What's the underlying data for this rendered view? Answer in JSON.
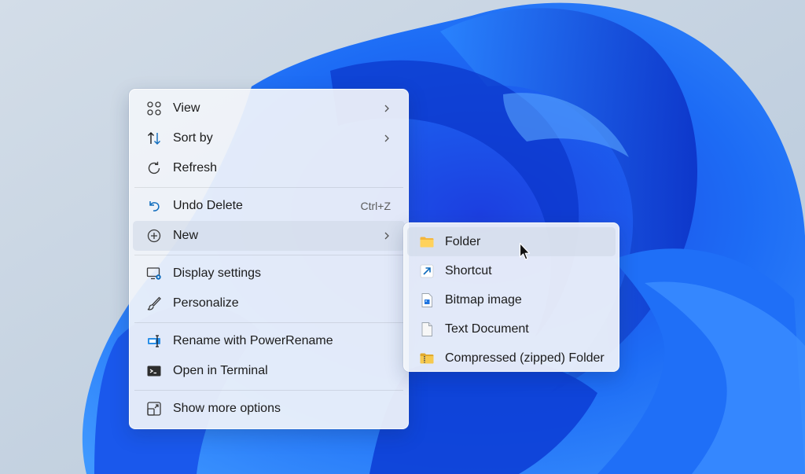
{
  "context_menu": {
    "items": [
      {
        "label": "View",
        "icon": "grid-icon"
      },
      {
        "label": "Sort by",
        "icon": "sort-icon"
      },
      {
        "label": "Refresh",
        "icon": "refresh-icon"
      },
      {
        "label": "Undo Delete",
        "shortcut": "Ctrl+Z",
        "icon": "undo-icon"
      },
      {
        "label": "New",
        "icon": "plus-circle-icon"
      },
      {
        "label": "Display settings",
        "icon": "display-settings-icon"
      },
      {
        "label": "Personalize",
        "icon": "brush-icon"
      },
      {
        "label": "Rename with PowerRename",
        "icon": "powerrename-icon"
      },
      {
        "label": "Open in Terminal",
        "icon": "terminal-icon"
      },
      {
        "label": "Show more options",
        "icon": "more-options-icon"
      }
    ]
  },
  "submenu_new": {
    "items": [
      {
        "label": "Folder",
        "icon": "folder-icon"
      },
      {
        "label": "Shortcut",
        "icon": "shortcut-icon"
      },
      {
        "label": "Bitmap image",
        "icon": "bitmap-icon"
      },
      {
        "label": "Text Document",
        "icon": "text-document-icon"
      },
      {
        "label": "Compressed (zipped) Folder",
        "icon": "zip-folder-icon"
      }
    ]
  },
  "colors": {
    "accent": "#0f6cbd",
    "wallpaper_blue": "#1565f0",
    "menu_background": "#f1f4fa"
  }
}
